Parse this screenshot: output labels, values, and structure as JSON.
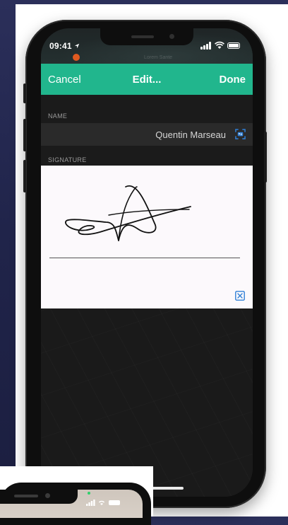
{
  "status_bar": {
    "time": "09:41",
    "map_label": "Lorem Sante"
  },
  "navbar": {
    "cancel_label": "Cancel",
    "title": "Edit...",
    "done_label": "Done"
  },
  "form": {
    "name_label": "NAME",
    "name_value": "Quentin Marseau",
    "signature_label": "SIGNATURE"
  },
  "colors": {
    "accent": "#21b68d",
    "icon_blue": "#2f7fd6",
    "background": "#23274d",
    "screen": "#1b1b1b",
    "signature_pad": "#fcf9fc"
  },
  "icons": {
    "location": "location-arrow-icon",
    "signal": "cellular-signal-icon",
    "wifi": "wifi-icon",
    "battery": "battery-icon",
    "contact": "contact-card-icon",
    "clear": "close-box-icon"
  }
}
